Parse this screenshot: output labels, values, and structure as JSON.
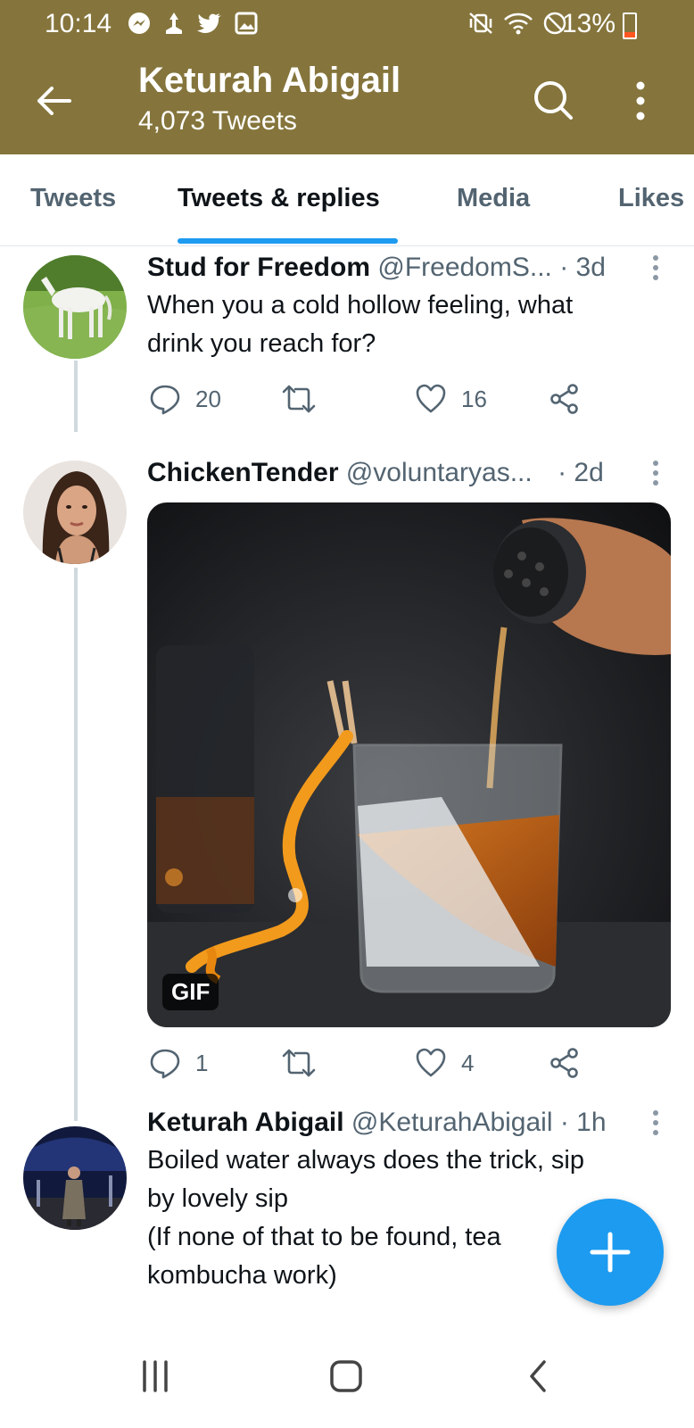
{
  "status_bar": {
    "time": "10:14",
    "battery": "13%"
  },
  "header": {
    "title": "Keturah Abigail",
    "subtitle": "4,073 Tweets"
  },
  "tabs": [
    {
      "label": "Tweets"
    },
    {
      "label": "Tweets & replies"
    },
    {
      "label": "Media"
    },
    {
      "label": "Likes"
    }
  ],
  "tweets": [
    {
      "name": "Stud for Freedom",
      "handle": "@FreedomS...",
      "time": "· 3d",
      "text_lines": [
        "When you a cold hollow feeling, what",
        "drink you reach for?"
      ],
      "replies": "20",
      "likes": "16"
    },
    {
      "name": "ChickenTender",
      "handle": "@voluntaryas...",
      "time": "· 2d",
      "media_badge": "GIF",
      "replies": "1",
      "likes": "4"
    },
    {
      "name": "Keturah Abigail",
      "handle": "@KeturahAbigail",
      "time": "· 1h",
      "text_lines": [
        "Boiled water always does the trick, sip",
        "by lovely sip",
        "(If none of that to be found, tea",
        "kombucha work)"
      ]
    }
  ],
  "colors": {
    "header_bg": "#85753c",
    "accent": "#1d9bf0"
  }
}
